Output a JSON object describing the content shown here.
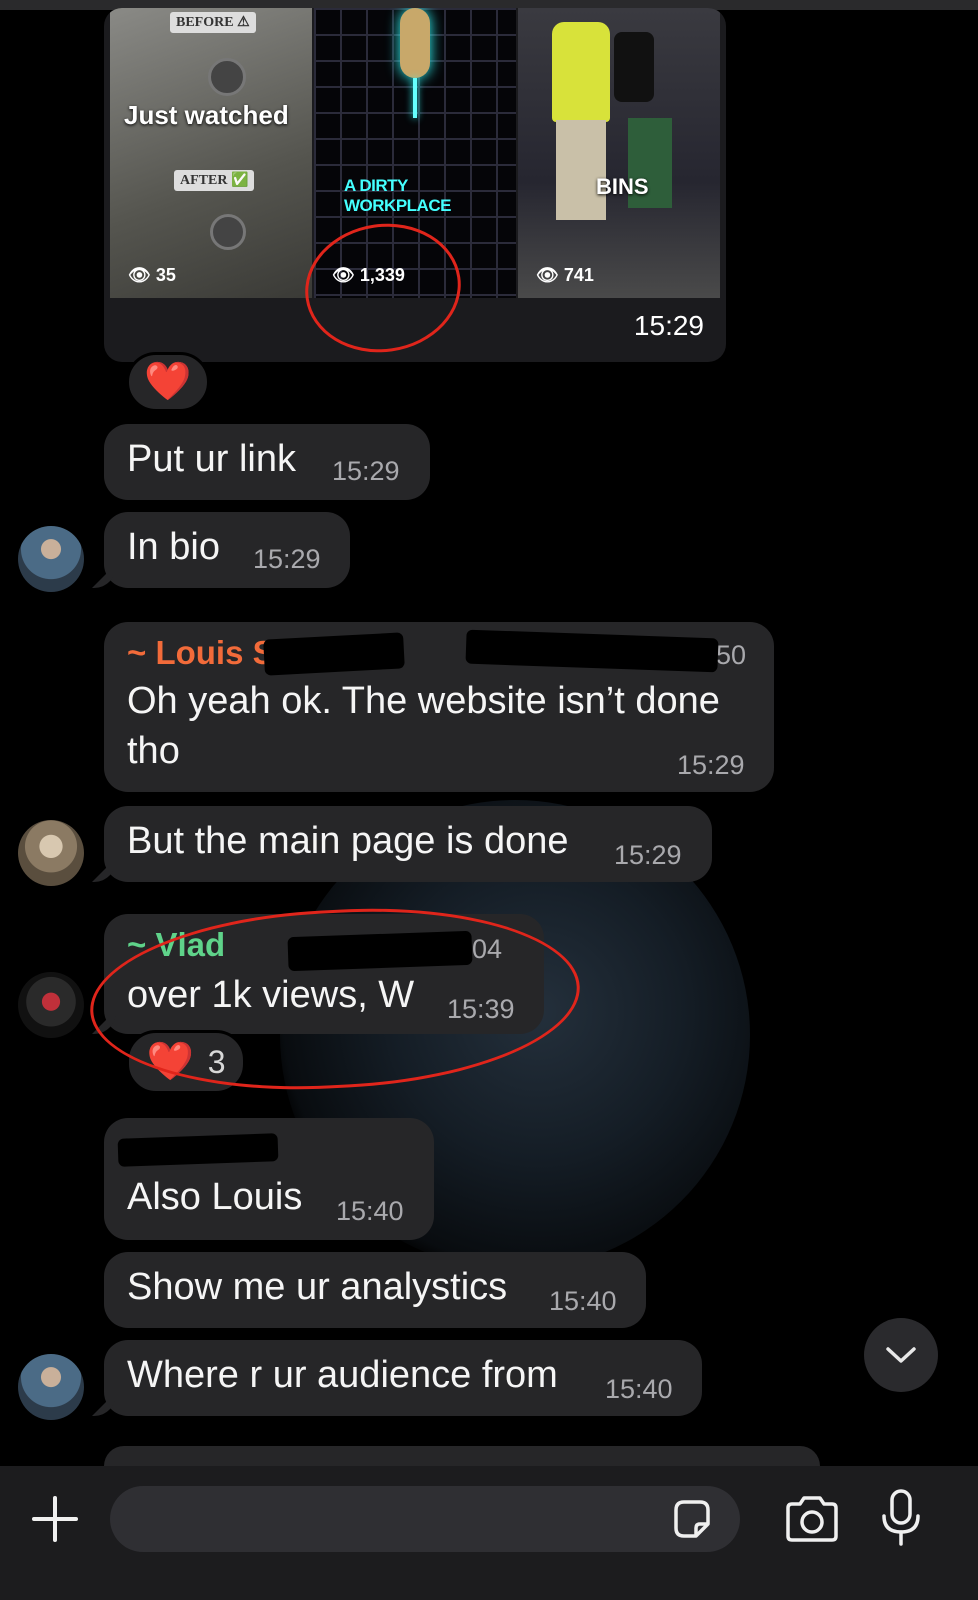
{
  "media": {
    "thumbs": [
      {
        "tag_before": "BEFORE ⚠",
        "caption": "Just watched",
        "tag_after": "AFTER ✅",
        "views": "35"
      },
      {
        "caption": "A DIRTY WORKPLACE",
        "views": "1,339"
      },
      {
        "caption": "BINS",
        "views": "741"
      }
    ],
    "time": "15:29",
    "reaction": "❤️"
  },
  "messages": [
    {
      "text": "Put ur link",
      "time": "15:29"
    },
    {
      "text": "In bio",
      "time": "15:29"
    },
    {
      "sender": "~ Louis S",
      "sender_tail": "50",
      "text_line1": "Oh yeah ok. The website isn’t done",
      "text_line2": "tho",
      "time": "15:29"
    },
    {
      "text": "But the main page is done",
      "time": "15:29"
    },
    {
      "sender": "~ Vlad",
      "sender_tail": "04",
      "text": "over 1k views, W",
      "time": "15:39",
      "reaction": "❤️",
      "reaction_count": "3"
    },
    {
      "sender": "–",
      "text": "Also Louis",
      "time": "15:40"
    },
    {
      "text": "Show me ur analystics",
      "time": "15:40"
    },
    {
      "text": "Where r ur audience from",
      "time": "15:40"
    }
  ],
  "composer": {
    "plus_icon": "plus-icon",
    "sticker_icon": "sticker-icon",
    "camera_icon": "camera-icon",
    "mic_icon": "microphone-icon"
  },
  "colors": {
    "bubble": "#262628",
    "louis": "#f26b3a",
    "vlad": "#5fd38a",
    "annotation": "#e0251b"
  }
}
